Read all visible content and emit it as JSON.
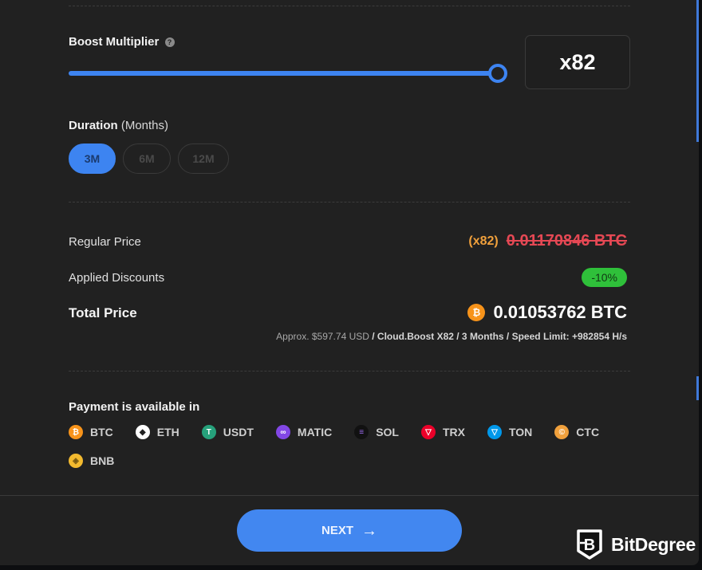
{
  "boost": {
    "label": "Boost Multiplier",
    "help_icon": "question-circle-icon",
    "slider_fraction": 1.0,
    "value_display": "x82"
  },
  "duration": {
    "label": "Duration",
    "unit": "(Months)",
    "options": [
      {
        "label": "3M",
        "selected": true
      },
      {
        "label": "6M",
        "selected": false
      },
      {
        "label": "12M",
        "selected": false
      }
    ]
  },
  "pricing": {
    "regular_label": "Regular Price",
    "regular_multiplier": "(x82)",
    "regular_value": "0.01170846 BTC",
    "discount_label": "Applied Discounts",
    "discount_value": "-10%",
    "total_label": "Total Price",
    "total_value": "0.01053762 BTC",
    "total_icon": "bitcoin-icon",
    "approx_prefix": "Approx. $597.74 USD",
    "approx_detail": " / Cloud.Boost X82 / 3 Months / Speed Limit: +982854 H/s"
  },
  "payment": {
    "label": "Payment is available in",
    "coins": [
      {
        "name": "BTC",
        "icon": "bitcoin-icon",
        "color": "#f7931a",
        "glyph": "₿"
      },
      {
        "name": "ETH",
        "icon": "ethereum-icon",
        "color": "#ffffff",
        "glyph": "◆"
      },
      {
        "name": "USDT",
        "icon": "tether-icon",
        "color": "#26a17b",
        "glyph": "T"
      },
      {
        "name": "MATIC",
        "icon": "polygon-icon",
        "color": "#8247e5",
        "glyph": "∞"
      },
      {
        "name": "SOL",
        "icon": "solana-icon",
        "color": "#111111",
        "glyph": "≡"
      },
      {
        "name": "TRX",
        "icon": "tron-icon",
        "color": "#eb0029",
        "glyph": "▽"
      },
      {
        "name": "TON",
        "icon": "toncoin-icon",
        "color": "#0098ea",
        "glyph": "▽"
      },
      {
        "name": "CTC",
        "icon": "creditcoin-icon",
        "color": "#f0a03c",
        "glyph": "©"
      },
      {
        "name": "BNB",
        "icon": "bnb-icon",
        "color": "#f3ba2f",
        "glyph": "◈"
      }
    ]
  },
  "footer": {
    "next_label": "NEXT",
    "next_icon": "arrow-right-icon",
    "brand": "BitDegree"
  },
  "colors": {
    "accent": "#3d84f1",
    "strike_red": "#e54854",
    "multiplier_orange": "#f0a03c",
    "discount_green": "#2fc03a",
    "background": "#212121"
  }
}
